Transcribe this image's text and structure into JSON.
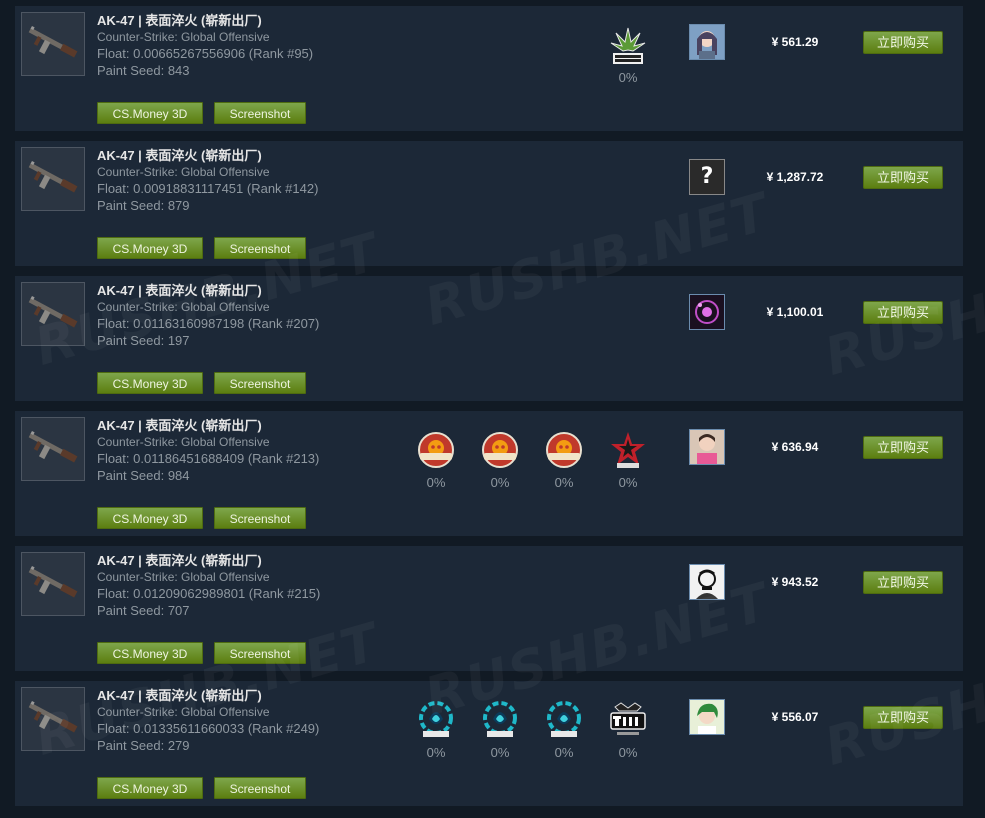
{
  "listings": [
    {
      "title": "AK-47 | 表面淬火 (崭新出厂)",
      "game": "Counter-Strike: Global Offensive",
      "float_text": "Float: 0.00665267556906 (Rank #95)",
      "seed_text": "Paint Seed: 843",
      "btn_3d": "CS.Money 3D",
      "btn_screenshot": "Screenshot",
      "stickers": [
        {
          "name": "drug-war-veteran-sticker",
          "pct": "0%"
        }
      ],
      "avatar": "anime-girl",
      "price": "¥ 561.29",
      "buy_label": "立即购买"
    },
    {
      "title": "AK-47 | 表面淬火 (崭新出厂)",
      "game": "Counter-Strike: Global Offensive",
      "float_text": "Float: 0.00918831117451 (Rank #142)",
      "seed_text": "Paint Seed: 879",
      "btn_3d": "CS.Money 3D",
      "btn_screenshot": "Screenshot",
      "stickers": [],
      "avatar": "question-mark",
      "avatar_text": "?",
      "price": "¥ 1,287.72",
      "buy_label": "立即购买"
    },
    {
      "title": "AK-47 | 表面淬火 (崭新出厂)",
      "game": "Counter-Strike: Global Offensive",
      "float_text": "Float: 0.01163160987198 (Rank #207)",
      "seed_text": "Paint Seed: 197",
      "btn_3d": "CS.Money 3D",
      "btn_screenshot": "Screenshot",
      "stickers": [],
      "avatar": "purple-orb",
      "price": "¥ 1,100.01",
      "buy_label": "立即购买"
    },
    {
      "title": "AK-47 | 表面淬火 (崭新出厂)",
      "game": "Counter-Strike: Global Offensive",
      "float_text": "Float: 0.01186451688409 (Rank #213)",
      "seed_text": "Paint Seed: 984",
      "btn_3d": "CS.Money 3D",
      "btn_screenshot": "Screenshot",
      "stickers": [
        {
          "name": "headshot-guarantee-sticker",
          "pct": "0%"
        },
        {
          "name": "headshot-guarantee-sticker",
          "pct": "0%"
        },
        {
          "name": "headshot-guarantee-sticker",
          "pct": "0%"
        },
        {
          "name": "mlg-star-sticker",
          "pct": "0%"
        }
      ],
      "avatar": "pink-shirt-person",
      "price": "¥ 636.94",
      "buy_label": "立即购买"
    },
    {
      "title": "AK-47 | 表面淬火 (崭新出厂)",
      "game": "Counter-Strike: Global Offensive",
      "float_text": "Float: 0.01209062989801 (Rank #215)",
      "seed_text": "Paint Seed: 707",
      "btn_3d": "CS.Money 3D",
      "btn_screenshot": "Screenshot",
      "stickers": [],
      "avatar": "sketch-face",
      "price": "¥ 943.52",
      "buy_label": "立即购买"
    },
    {
      "title": "AK-47 | 表面淬火 (崭新出厂)",
      "game": "Counter-Strike: Global Offensive",
      "float_text": "Float: 0.01335611660033 (Rank #249)",
      "seed_text": "Paint Seed: 279",
      "btn_3d": "CS.Money 3D",
      "btn_screenshot": "Screenshot",
      "stickers": [
        {
          "name": "mlg-liquid-sticker",
          "pct": "0%"
        },
        {
          "name": "mlg-liquid-sticker",
          "pct": "0%"
        },
        {
          "name": "mlg-liquid-sticker",
          "pct": "0%"
        },
        {
          "name": "tarik-autograph-sticker",
          "pct": "0%"
        }
      ],
      "avatar": "green-hair-anime",
      "price": "¥ 556.07",
      "buy_label": "立即购买"
    }
  ],
  "watermark": "RUSHB.NET",
  "colors": {
    "row_bg": "#1c2837",
    "page_bg": "#111a24",
    "button_green": "#6b8f2a",
    "text_muted": "#8f98a0"
  }
}
